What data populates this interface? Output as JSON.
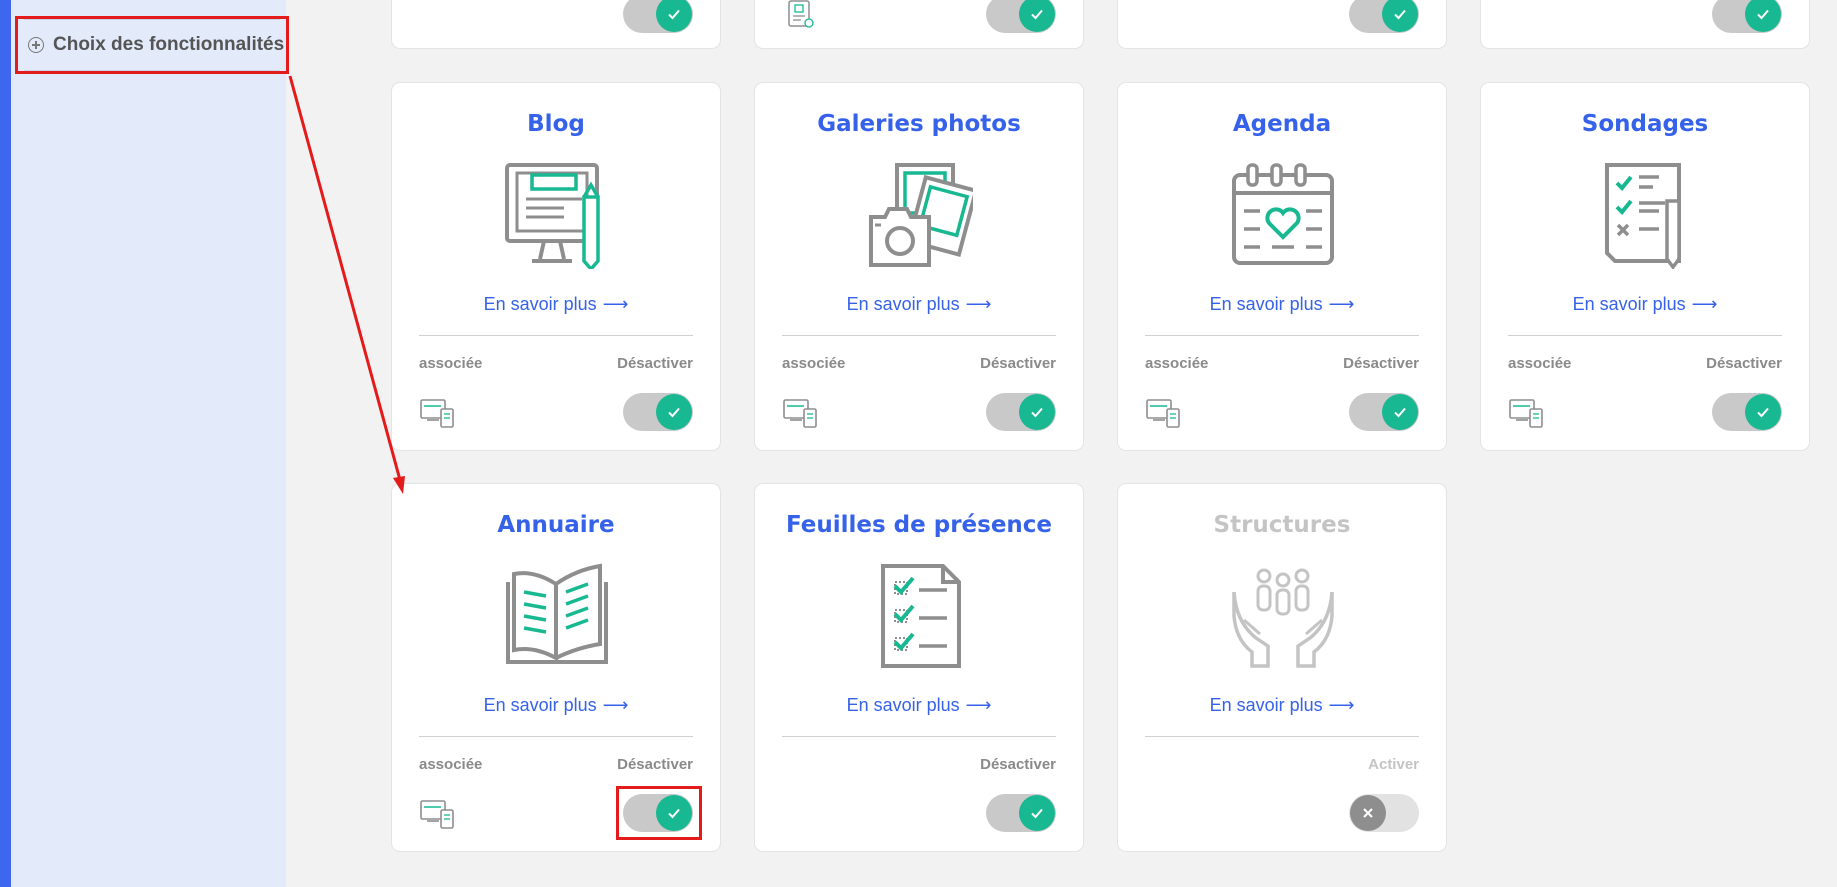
{
  "sidebar": {
    "item_label": "Choix des fonctionnalités"
  },
  "common": {
    "learn_more": "En savoir plus",
    "assoc": "associée"
  },
  "colors": {
    "accent": "#3562e8",
    "teal": "#17b892",
    "highlight": "#e31b1b"
  },
  "cards": [
    {
      "title": "Blog",
      "icon": "blog-icon",
      "assoc": true,
      "toggle_label": "Désactiver",
      "active": true
    },
    {
      "title": "Galeries photos",
      "icon": "photo-gallery-icon",
      "assoc": true,
      "toggle_label": "Désactiver",
      "active": true
    },
    {
      "title": "Agenda",
      "icon": "calendar-icon",
      "assoc": true,
      "toggle_label": "Désactiver",
      "active": true
    },
    {
      "title": "Sondages",
      "icon": "survey-icon",
      "assoc": true,
      "toggle_label": "Désactiver",
      "active": true
    },
    {
      "title": "Annuaire",
      "icon": "directory-icon",
      "assoc": true,
      "toggle_label": "Désactiver",
      "active": true
    },
    {
      "title": "Feuilles de présence",
      "icon": "attendance-sheet-icon",
      "assoc": false,
      "toggle_label": "Désactiver",
      "active": true
    },
    {
      "title": "Structures",
      "icon": "structures-icon",
      "assoc": false,
      "toggle_label": "Activer",
      "active": false
    }
  ]
}
